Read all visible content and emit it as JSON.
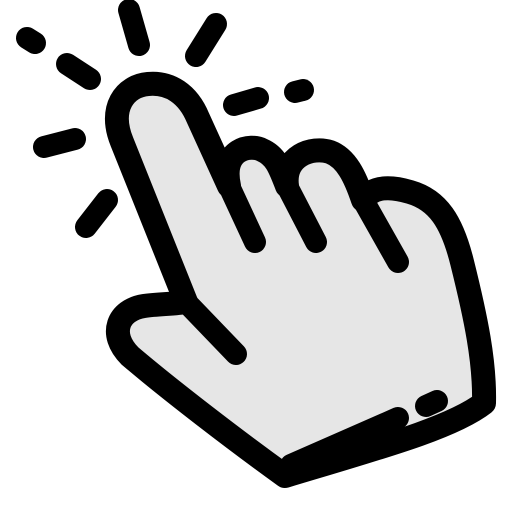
{
  "icon": {
    "semantic": "pointing-hand-click-icon",
    "colors": {
      "outline": "#000000",
      "fill": "#e6e6e6",
      "background": "#ffffff"
    }
  }
}
